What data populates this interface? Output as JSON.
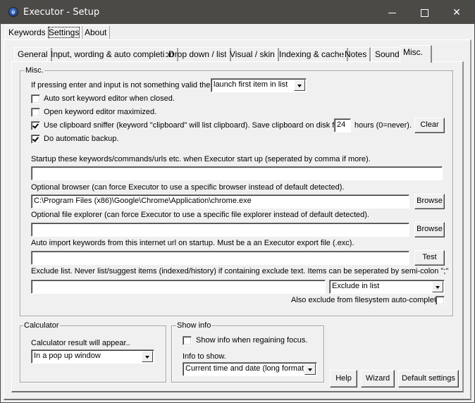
{
  "window": {
    "title": "Executor - Setup",
    "icon": "executor-logo-icon",
    "controls": {
      "minimize": "minimize-icon",
      "maximize": "maximize-icon",
      "close": "✕"
    }
  },
  "top_tabs": [
    {
      "label": "Keywords",
      "active": false
    },
    {
      "label": "Settings",
      "active": true
    },
    {
      "label": "About",
      "active": false
    }
  ],
  "inner_tabs": [
    {
      "label": "General",
      "active": false
    },
    {
      "label": "Input, wording & auto completion",
      "active": false
    },
    {
      "label": "Drop down / list",
      "active": false
    },
    {
      "label": "Visual / skin",
      "active": false
    },
    {
      "label": "Indexing & cache",
      "active": false
    },
    {
      "label": "Notes",
      "active": false
    },
    {
      "label": "Sound",
      "active": false
    },
    {
      "label": "Misc.",
      "active": true
    }
  ],
  "misc": {
    "legend": "Misc.",
    "enter_invalid_label": "If pressing enter and input is not something valid then",
    "enter_invalid_value": "launch first item in list",
    "auto_sort": {
      "label": "Auto sort keyword editor when closed.",
      "checked": false
    },
    "open_maximized": {
      "label": "Open keyword editor maximized.",
      "checked": false
    },
    "clipboard_sniffer": {
      "label": "Use clipboard sniffer (keyword \"clipboard\" will list clipboard). Save clipboard on disk for",
      "checked": true
    },
    "clipboard_hours": "24",
    "clipboard_hours_suffix": "hours (0=never).",
    "clear_button": "Clear",
    "auto_backup": {
      "label": "Do automatic backup.",
      "checked": true
    },
    "startup_label": "Startup these keywords/commands/urls etc. when Executor start up (seperated by comma if more).",
    "startup_value": "",
    "browser_label": "Optional browser (can force Executor to use a specific browser instead of default detected).",
    "browser_value": "C:\\Program Files (x86)\\Google\\Chrome\\Application\\chrome.exe",
    "browse_button": "Browse",
    "explorer_label": "Optional file explorer (can force Executor to use a specific file explorer instead of default detected).",
    "explorer_value": "",
    "import_label": "Auto import keywords from this internet url on startup. Must be a an Executor export file (.exc).",
    "import_value": "",
    "test_button": "Test",
    "exclude_label": "Exclude list. Never list/suggest items (indexed/history) if containing exclude text. Items can be seperated by semi-colon \";\"",
    "exclude_value": "",
    "exclude_mode": "Exclude in list",
    "exclude_filesystem": {
      "label": "Also exclude from filesystem auto-complete",
      "checked": false
    }
  },
  "calculator": {
    "legend": "Calculator",
    "label": "Calculator result will appear..",
    "value": "In a pop up window"
  },
  "show_info": {
    "legend": "Show info",
    "regain_focus": {
      "label": "Show info when regaining focus.",
      "checked": false
    },
    "info_label": "Info to show.",
    "info_value": "Current time and date (long format)"
  },
  "footer": {
    "help": "Help",
    "wizard": "Wizard",
    "default_settings": "Default settings"
  }
}
